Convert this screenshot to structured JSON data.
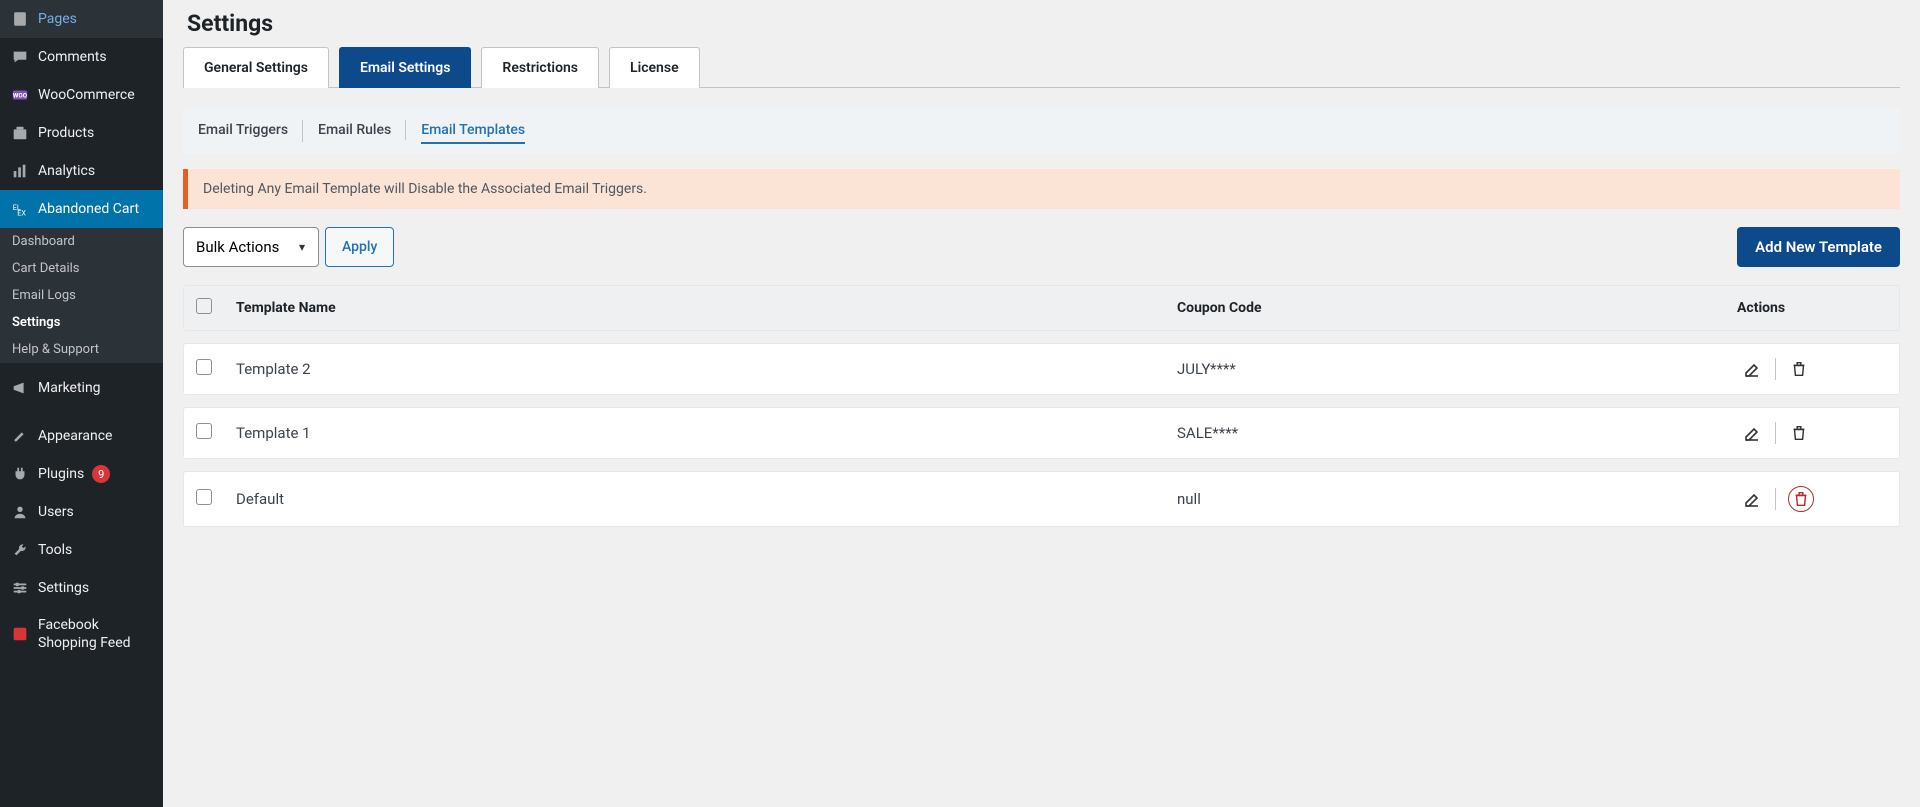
{
  "sidebar": {
    "top": [
      {
        "label": "Pages",
        "icon": "page"
      },
      {
        "label": "Comments",
        "icon": "comment"
      },
      {
        "label": "WooCommerce",
        "icon": "woo"
      },
      {
        "label": "Products",
        "icon": "product"
      },
      {
        "label": "Analytics",
        "icon": "analytics"
      }
    ],
    "active": {
      "label": "Abandoned Cart",
      "icon": "elex"
    },
    "sub": [
      {
        "label": "Dashboard"
      },
      {
        "label": "Cart Details"
      },
      {
        "label": "Email Logs"
      },
      {
        "label": "Settings",
        "current": true
      },
      {
        "label": "Help & Support"
      }
    ],
    "bottom": [
      {
        "label": "Marketing",
        "icon": "mega"
      },
      {
        "label": "Appearance",
        "icon": "brush"
      },
      {
        "label": "Plugins",
        "icon": "plug",
        "badge": "9"
      },
      {
        "label": "Users",
        "icon": "user"
      },
      {
        "label": "Tools",
        "icon": "wrench"
      },
      {
        "label": "Settings",
        "icon": "sliders"
      },
      {
        "label": "Facebook Shopping Feed",
        "icon": "feed"
      }
    ]
  },
  "page_title": "Settings",
  "primary_tabs": [
    {
      "label": "General Settings",
      "active": false
    },
    {
      "label": "Email Settings",
      "active": true
    },
    {
      "label": "Restrictions",
      "active": false
    },
    {
      "label": "License",
      "active": false
    }
  ],
  "secondary_tabs": [
    {
      "label": "Email Triggers",
      "active": false
    },
    {
      "label": "Email Rules",
      "active": false
    },
    {
      "label": "Email Templates",
      "active": true
    }
  ],
  "alert": "Deleting Any Email Template will Disable the Associated Email Triggers.",
  "bulk_select": "Bulk Actions",
  "apply_label": "Apply",
  "add_new_label": "Add New Template",
  "columns": {
    "name": "Template Name",
    "coupon": "Coupon Code",
    "actions": "Actions"
  },
  "rows": [
    {
      "name": "Template 2",
      "coupon": "JULY****",
      "delete_circled": false
    },
    {
      "name": "Template 1",
      "coupon": "SALE****",
      "delete_circled": false
    },
    {
      "name": "Default",
      "coupon": "null",
      "delete_circled": true
    }
  ]
}
